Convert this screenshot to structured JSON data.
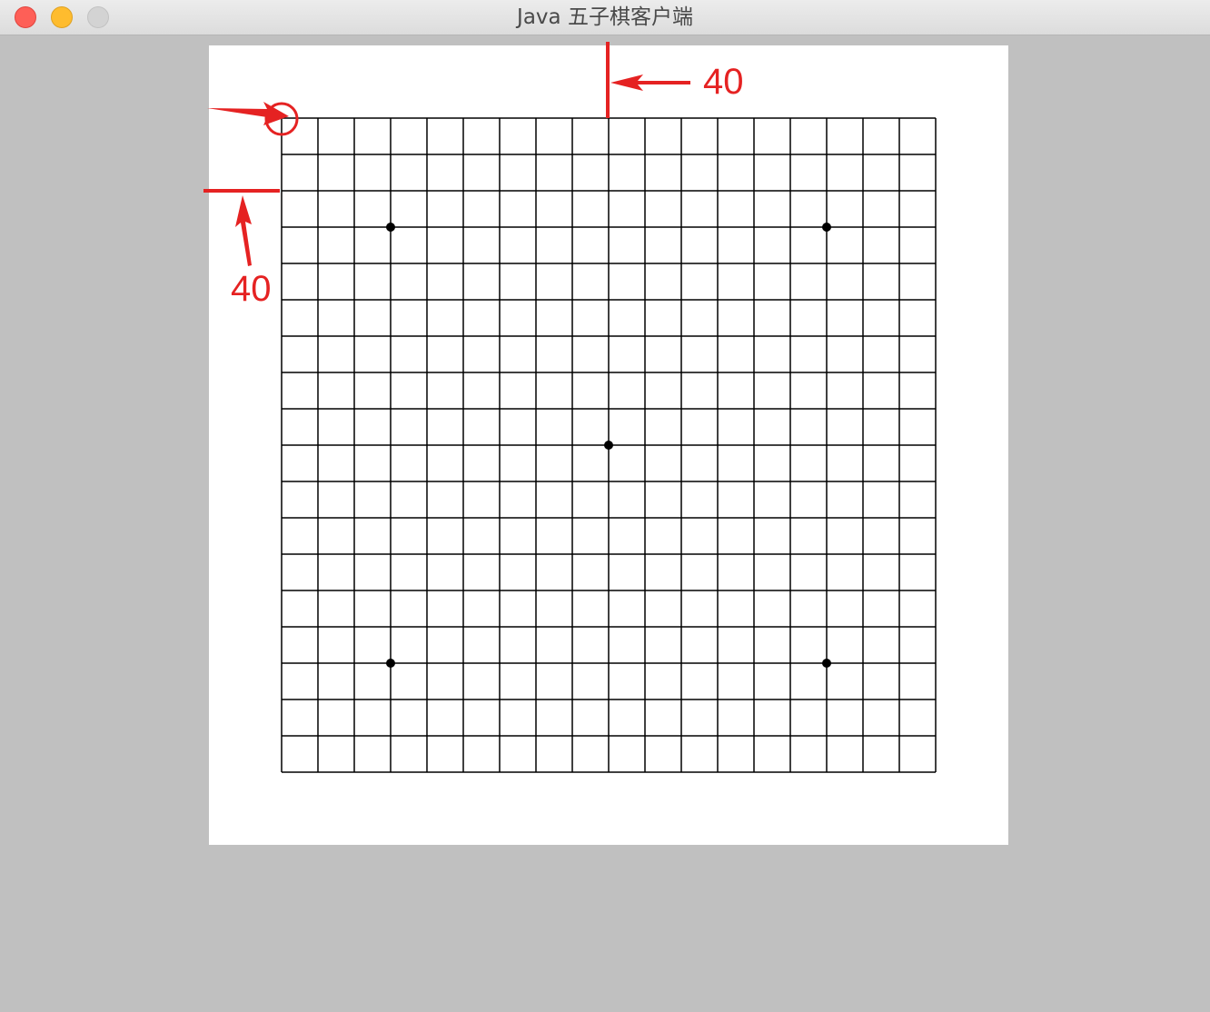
{
  "window": {
    "title": "Java 五子棋客户端",
    "controls": [
      "close",
      "minimize",
      "zoom"
    ]
  },
  "board": {
    "lines": 19,
    "star_points": [
      [
        3,
        3
      ],
      [
        15,
        3
      ],
      [
        9,
        9
      ],
      [
        3,
        15
      ],
      [
        15,
        15
      ]
    ],
    "line_color": "#000000",
    "background": "#ffffff"
  },
  "annotations": {
    "color": "#e52222",
    "top_margin_label": "40",
    "left_margin_label": "40"
  },
  "colors": {
    "window_bg": "#c0c0c0",
    "annotation": "#e52222"
  }
}
